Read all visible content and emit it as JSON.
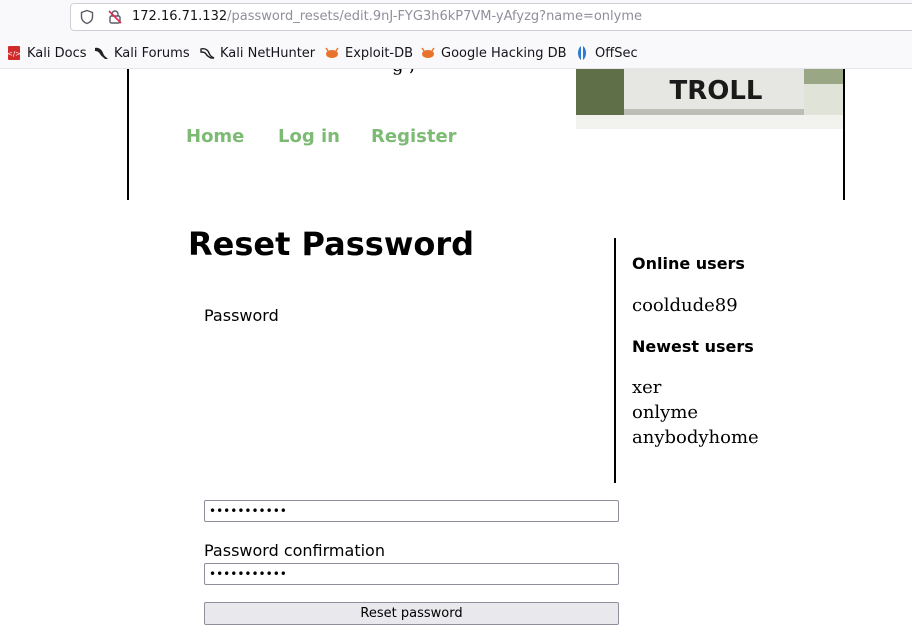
{
  "browser": {
    "url_host": "172.16.71.132",
    "url_path": "/password_resets/edit.9nJ-FYG3h6kP7VM-yAfyzg?name=onlyme",
    "bookmarks": [
      {
        "label": "Kali Docs",
        "icon": "kali-docs-icon"
      },
      {
        "label": "Kali Forums",
        "icon": "kali-dragon-icon"
      },
      {
        "label": "Kali NetHunter",
        "icon": "kali-dragon-icon"
      },
      {
        "label": "Exploit-DB",
        "icon": "exploit-db-icon"
      },
      {
        "label": "Google Hacking DB",
        "icon": "exploit-db-icon"
      },
      {
        "label": "OffSec",
        "icon": "offsec-icon"
      }
    ]
  },
  "header": {
    "cut_off_text": "g ,",
    "banner_text": "TROLL",
    "nav": [
      "Home",
      "Log in",
      "Register"
    ]
  },
  "main": {
    "title": "Reset Password",
    "password_label": "Password",
    "password_value": "•••••••••••",
    "confirm_label": "Password confirmation",
    "confirm_value": "•••••••••••",
    "submit_label": "Reset password"
  },
  "sidebar": {
    "online_heading": "Online users",
    "online_users": [
      "cooldude89"
    ],
    "newest_heading": "Newest users",
    "newest_users": [
      "xer",
      "onlyme",
      "anybodyhome"
    ]
  },
  "colors": {
    "nav_link": "#7dbb75",
    "field_border": "#8f8f9d",
    "button_bg": "#e9e9ed"
  }
}
